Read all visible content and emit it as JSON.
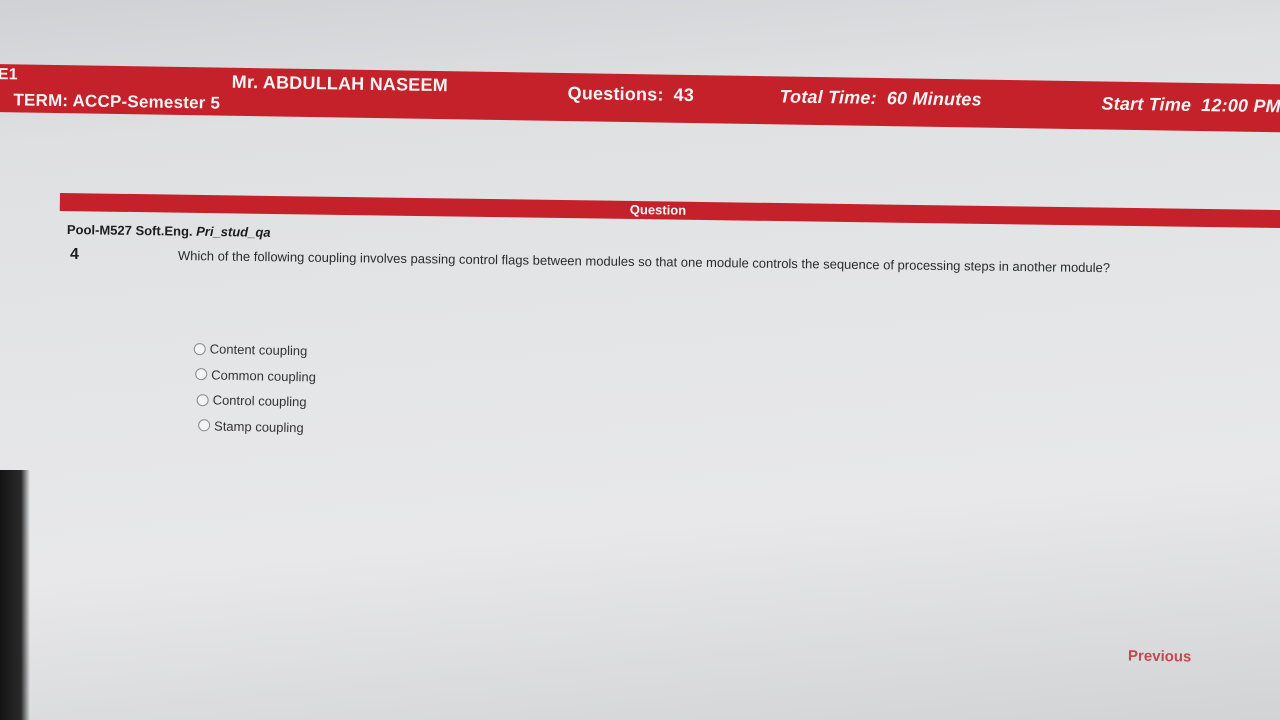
{
  "header": {
    "code": "E1",
    "instructor": "Mr. ABDULLAH NASEEM",
    "term": "TERM: ACCP-Semester 5",
    "questions_label": "Questions:",
    "questions_value": "43",
    "total_time_label": "Total Time:",
    "total_time_value": "60 Minutes",
    "start_time_label": "Start Time",
    "start_time_value": "12:00 PM",
    "bar_color": "#c4212a"
  },
  "question_section": {
    "title": "Question",
    "pool_label": "Pool-M527 Soft.Eng.",
    "pool_label_tail": "Pri_stud_qa",
    "number": "4",
    "text": "Which of the following coupling involves passing control flags between modules so that one module controls the sequence of processing steps in another module?",
    "options": [
      {
        "label": "Content coupling",
        "selected": false
      },
      {
        "label": "Common coupling",
        "selected": false
      },
      {
        "label": "Control coupling",
        "selected": false
      },
      {
        "label": "Stamp coupling",
        "selected": false
      }
    ]
  },
  "navigation": {
    "previous_label": "Previous"
  },
  "colors": {
    "accent": "#c4212a",
    "previous_text": "#c24a4f"
  }
}
